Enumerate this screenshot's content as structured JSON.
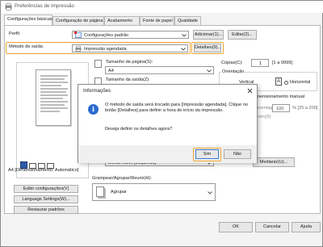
{
  "window": {
    "title": "Preferências de Impressão"
  },
  "tabs": [
    "Configurações básicas",
    "Configuração de página",
    "Acabamento",
    "Fonte de papel",
    "Qualidade"
  ],
  "profile": {
    "label": "Perfil:",
    "value": "Configurações padrão",
    "add_btn": "Adicionar(1)...",
    "edit_btn": "Editar(2)..."
  },
  "output": {
    "label": "Método de saída:",
    "value": "Impressão agendada",
    "details_btn": "Detalhes(9)..."
  },
  "page_size": {
    "label": "Tamanho da página(S):",
    "value": "A4"
  },
  "output_size": {
    "label": "Tamanho da saída(Z):"
  },
  "copies": {
    "label": "Cópias(C):",
    "value": "1",
    "range": "[1 a 9999]"
  },
  "orientation": {
    "label": "Orientação",
    "portrait": "Vertical",
    "landscape": "Horizontal"
  },
  "scaling": {
    "label": "Dimensionamento manual",
    "value": "100",
    "range": "% [25 a 200]",
    "ratio_label": "Porcentagem(L):",
    "center_label": "Centro(5)"
  },
  "binding": {
    "value": "Borda maior [Esquerda]",
    "margin_btn": "Medianiz(U)..."
  },
  "staple": {
    "label": "Grampear/Agrupar/Reunir(H):",
    "value": "Agrupar"
  },
  "preview": {
    "caption": "A4 [Dimensionamento: Automático]"
  },
  "left_buttons": [
    "Exibir configurações(V)",
    "Language Settings(W)...",
    "Restaurar padrões"
  ],
  "bottom_buttons": [
    "OK",
    "Cancelar",
    "Ajuda"
  ],
  "dialog": {
    "title": "Informações",
    "message": "O método de saída será trocado para [Impressão agendada]. Clique no botão [Detalhes] para definir a hora de início da impressão.",
    "question": "Deseja definir os detalhes agora?",
    "yes": "Sim",
    "no": "Não"
  },
  "colors": {
    "highlight": "#f0a432",
    "info_blue": "#2a6ccc"
  }
}
